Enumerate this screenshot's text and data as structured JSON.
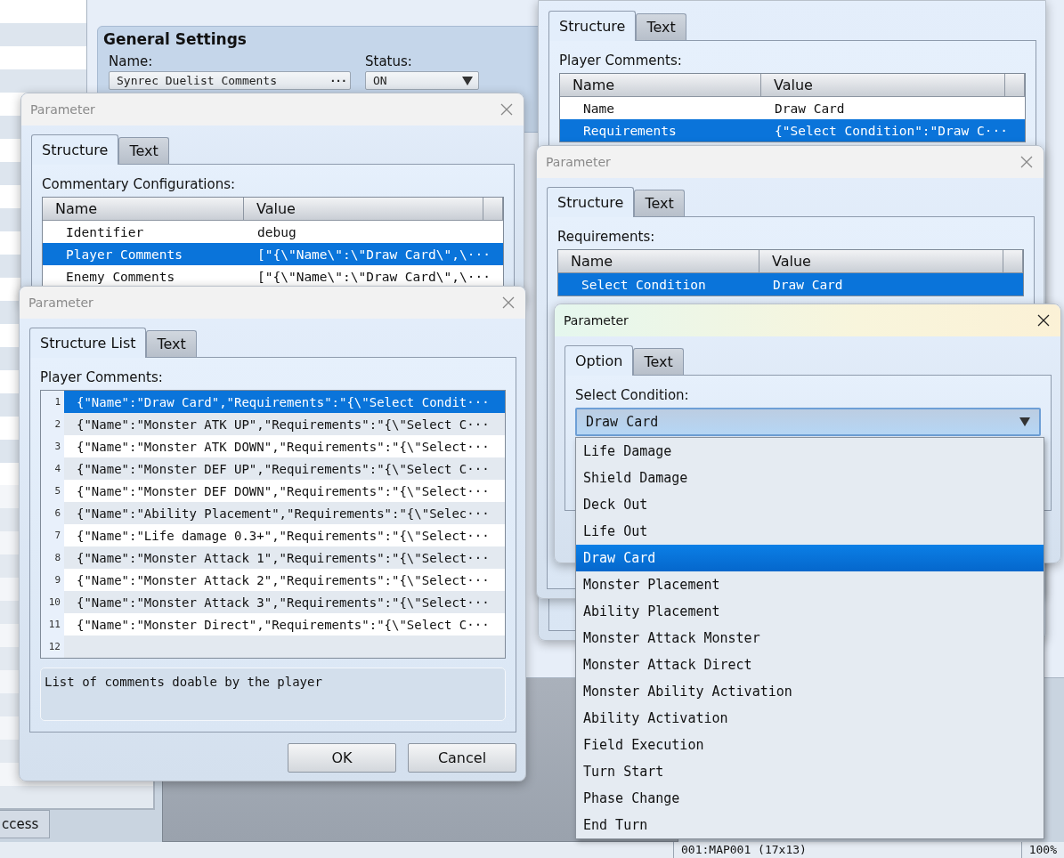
{
  "plugin_settings": {
    "group_title": "General Settings",
    "fields": [
      {
        "kind": "text",
        "label": "Name:",
        "value": "Synrec Duelist Comments",
        "button": "···"
      },
      {
        "kind": "combo",
        "label": "Status:",
        "value": "ON"
      }
    ]
  },
  "dialogs": [
    {
      "kind": "table",
      "tabs": [
        {
          "label": "Structure",
          "selected": true
        },
        {
          "label": "Text",
          "selected": false
        }
      ],
      "label": "Player Comments:",
      "columns": [
        "Name",
        "Value"
      ],
      "rows": [
        {
          "name": "Name",
          "value": "Draw Card",
          "selected": false
        },
        {
          "name": "Requirements",
          "value": "{\"Select Condition\":\"Draw C···",
          "selected": true
        }
      ]
    },
    {
      "kind": "table",
      "title": "Parameter",
      "tabs": [
        {
          "label": "Structure",
          "selected": true
        },
        {
          "label": "Text",
          "selected": false
        }
      ],
      "label": "Commentary Configurations:",
      "columns": [
        "Name",
        "Value"
      ],
      "rows": [
        {
          "name": "Identifier",
          "value": "debug",
          "selected": false
        },
        {
          "name": "Player Comments",
          "value": "[\"{\\\"Name\\\":\\\"Draw Card\\\",\\···",
          "selected": true
        },
        {
          "name": "Enemy Comments",
          "value": "[\"{\\\"Name\\\":\\\"Draw Card\\\",\\···",
          "selected": false
        }
      ]
    },
    {
      "kind": "list",
      "title": "Parameter",
      "tabs": [
        {
          "label": "Structure List",
          "selected": true
        },
        {
          "label": "Text",
          "selected": false
        }
      ],
      "label": "Player Comments:",
      "items": [
        {
          "number": "1",
          "text": "{\"Name\":\"Draw Card\",\"Requirements\":\"{\\\"Select Condit···",
          "selected": true
        },
        {
          "number": "2",
          "text": "{\"Name\":\"Monster ATK UP\",\"Requirements\":\"{\\\"Select C···",
          "selected": false
        },
        {
          "number": "3",
          "text": "{\"Name\":\"Monster ATK DOWN\",\"Requirements\":\"{\\\"Select···",
          "selected": false
        },
        {
          "number": "4",
          "text": "{\"Name\":\"Monster DEF UP\",\"Requirements\":\"{\\\"Select C···",
          "selected": false
        },
        {
          "number": "5",
          "text": "{\"Name\":\"Monster DEF DOWN\",\"Requirements\":\"{\\\"Select···",
          "selected": false
        },
        {
          "number": "6",
          "text": "{\"Name\":\"Ability Placement\",\"Requirements\":\"{\\\"Selec···",
          "selected": false
        },
        {
          "number": "7",
          "text": "{\"Name\":\"Life damage 0.3+\",\"Requirements\":\"{\\\"Select···",
          "selected": false
        },
        {
          "number": "8",
          "text": "{\"Name\":\"Monster Attack 1\",\"Requirements\":\"{\\\"Select···",
          "selected": false
        },
        {
          "number": "9",
          "text": "{\"Name\":\"Monster Attack 2\",\"Requirements\":\"{\\\"Select···",
          "selected": false
        },
        {
          "number": "10",
          "text": "{\"Name\":\"Monster Attack 3\",\"Requirements\":\"{\\\"Select···",
          "selected": false
        },
        {
          "number": "11",
          "text": "{\"Name\":\"Monster Direct\",\"Requirements\":\"{\\\"Select C···",
          "selected": false
        },
        {
          "number": "12",
          "selected": false
        }
      ],
      "description": "List of comments doable by the player",
      "buttons": [
        "OK",
        "Cancel"
      ]
    },
    {
      "kind": "table",
      "title": "Parameter",
      "tabs": [
        {
          "label": "Structure",
          "selected": true
        },
        {
          "label": "Text",
          "selected": false
        }
      ],
      "label": "Requirements:",
      "columns": [
        "Name",
        "Value"
      ],
      "rows": [
        {
          "name": "Select Condition",
          "value": "Draw Card",
          "selected": true
        }
      ]
    },
    {
      "kind": "option",
      "title": "Parameter",
      "active": true,
      "tabs": [
        {
          "label": "Option",
          "selected": true
        },
        {
          "label": "Text",
          "selected": false
        }
      ],
      "label": "Select Condition:",
      "value": "Draw Card",
      "options": [
        {
          "label": "Life Damage",
          "selected": false
        },
        {
          "label": "Shield Damage",
          "selected": false
        },
        {
          "label": "Deck Out",
          "selected": false
        },
        {
          "label": "Life Out",
          "selected": false
        },
        {
          "label": "Draw Card",
          "selected": true
        },
        {
          "label": "Monster Placement",
          "selected": false
        },
        {
          "label": "Ability Placement",
          "selected": false
        },
        {
          "label": "Monster Attack Monster",
          "selected": false
        },
        {
          "label": "Monster Attack Direct",
          "selected": false
        },
        {
          "label": "Monster Ability Activation",
          "selected": false
        },
        {
          "label": "Ability Activation",
          "selected": false
        },
        {
          "label": "Field Execution",
          "selected": false
        },
        {
          "label": "Turn Start",
          "selected": false
        },
        {
          "label": "Phase Change",
          "selected": false
        },
        {
          "label": "End Turn",
          "selected": false
        }
      ]
    }
  ],
  "side_tab": "ccess",
  "status_bar": {
    "map": "001:MAP001 (17x13)",
    "zoom": "100%"
  }
}
